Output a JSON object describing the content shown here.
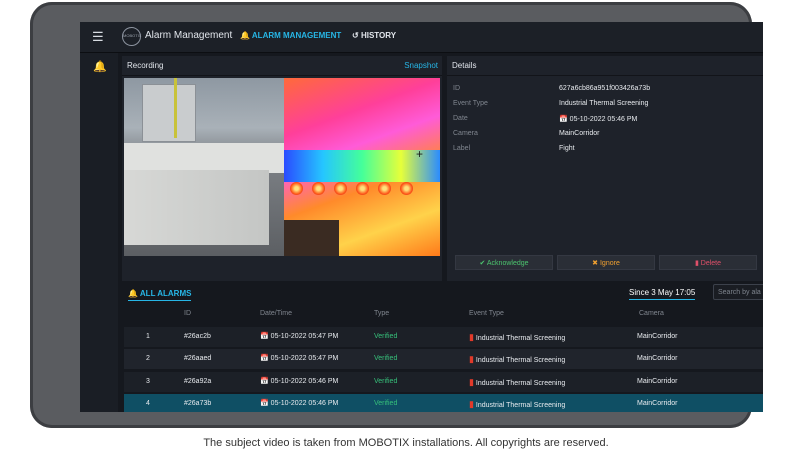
{
  "app": {
    "logo_text": "MOBOTIX",
    "title": "Alarm Management"
  },
  "nav": {
    "alarm_management": "ALARM MANAGEMENT",
    "history": "HISTORY"
  },
  "recording": {
    "title": "Recording",
    "snapshot": "Snapshot"
  },
  "details": {
    "title": "Details",
    "fields": [
      {
        "label": "ID",
        "value": "627a6cb86a951f003426a73b"
      },
      {
        "label": "Event Type",
        "value": "Industrial Thermal Screening"
      },
      {
        "label": "Date",
        "value": "05-10-2022 05:46 PM"
      },
      {
        "label": "Camera",
        "value": "MainCorridor"
      },
      {
        "label": "Label",
        "value": "Fight"
      }
    ]
  },
  "actions": {
    "acknowledge": "Acknowledge",
    "ignore": "Ignore",
    "delete": "Delete"
  },
  "alarms": {
    "tab": "ALL ALARMS",
    "since": "Since 3 May 17:05",
    "search_placeholder": "Search by ala",
    "columns": [
      "ID",
      "Date/Time",
      "Type",
      "Event Type",
      "Camera"
    ],
    "rows": [
      {
        "num": "1",
        "id": "#26ac2b",
        "datetime": "05-10-2022 05:47 PM",
        "type": "Verified",
        "event": "Industrial Thermal Screening",
        "camera": "MainCorridor"
      },
      {
        "num": "2",
        "id": "#26aaed",
        "datetime": "05-10-2022 05:47 PM",
        "type": "Verified",
        "event": "Industrial Thermal Screening",
        "camera": "MainCorridor"
      },
      {
        "num": "3",
        "id": "#26a92a",
        "datetime": "05-10-2022 05:46 PM",
        "type": "Verified",
        "event": "Industrial Thermal Screening",
        "camera": "MainCorridor"
      },
      {
        "num": "4",
        "id": "#26a73b",
        "datetime": "05-10-2022 05:46 PM",
        "type": "Verified",
        "event": "Industrial Thermal Screening",
        "camera": "MainCorridor"
      }
    ]
  },
  "caption": "The subject video is taken from MOBOTIX installations. All copyrights are reserved.",
  "colors": {
    "accent": "#27b6e6",
    "verified": "#36c07a",
    "delete": "#e0506a",
    "acknowledge": "#4cc46e",
    "ignore": "#f0a030",
    "selected_row": "#0f4f64"
  }
}
